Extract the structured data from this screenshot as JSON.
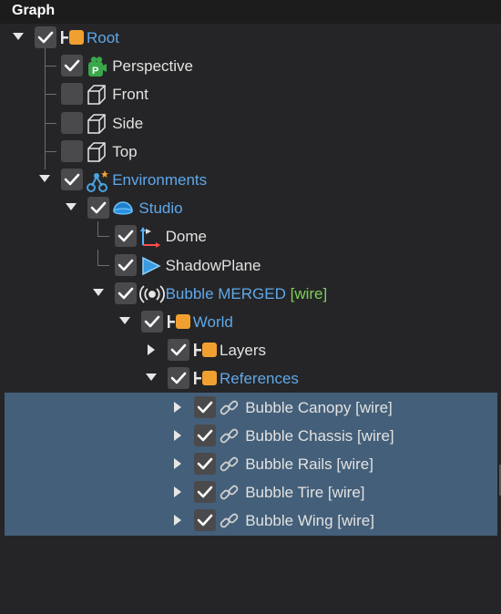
{
  "panel": {
    "title": "Graph"
  },
  "colors": {
    "label_default": "#e2e2e2",
    "label_blue": "#5fa8ea",
    "tag_green": "#7ccf58",
    "icon_orange": "#f0a030",
    "selection": "#445f79"
  },
  "tree": {
    "rows": [
      {
        "id": "root",
        "label": "Root",
        "tag": "",
        "icon": "group-node-icon",
        "checked": true,
        "expander": "expanded",
        "label_color": "blue",
        "selected": false
      },
      {
        "id": "perspective",
        "label": "Perspective",
        "tag": "",
        "icon": "perspective-camera-icon",
        "checked": true,
        "expander": "none",
        "label_color": "default",
        "selected": false
      },
      {
        "id": "front",
        "label": "Front",
        "tag": "",
        "icon": "ortho-camera-icon",
        "checked": false,
        "expander": "none",
        "label_color": "default",
        "selected": false
      },
      {
        "id": "side",
        "label": "Side",
        "tag": "",
        "icon": "ortho-camera-icon",
        "checked": false,
        "expander": "none",
        "label_color": "default",
        "selected": false
      },
      {
        "id": "top",
        "label": "Top",
        "tag": "",
        "icon": "ortho-camera-icon",
        "checked": false,
        "expander": "none",
        "label_color": "default",
        "selected": false
      },
      {
        "id": "environments",
        "label": "Environments",
        "tag": "",
        "icon": "environments-icon",
        "checked": true,
        "expander": "expanded",
        "label_color": "blue",
        "selected": false
      },
      {
        "id": "studio",
        "label": "Studio",
        "tag": "",
        "icon": "environment-dome-icon",
        "checked": true,
        "expander": "expanded",
        "label_color": "blue",
        "selected": false
      },
      {
        "id": "dome",
        "label": "Dome",
        "tag": "",
        "icon": "dome-light-icon",
        "checked": true,
        "expander": "none",
        "label_color": "default",
        "selected": false
      },
      {
        "id": "shadowplane",
        "label": "ShadowPlane",
        "tag": "",
        "icon": "shadow-plane-icon",
        "checked": true,
        "expander": "none",
        "label_color": "default",
        "selected": false
      },
      {
        "id": "bubble-merged",
        "label": "Bubble MERGED",
        "tag": "[wire]",
        "icon": "radio-source-icon",
        "checked": true,
        "expander": "expanded",
        "label_color": "blue",
        "selected": false
      },
      {
        "id": "world",
        "label": "World",
        "tag": "",
        "icon": "group-node-icon",
        "checked": true,
        "expander": "expanded",
        "label_color": "blue",
        "selected": false
      },
      {
        "id": "layers",
        "label": "Layers",
        "tag": "",
        "icon": "group-node-icon",
        "checked": true,
        "expander": "collapsed",
        "label_color": "default",
        "selected": false
      },
      {
        "id": "references",
        "label": "References",
        "tag": "",
        "icon": "group-node-icon",
        "checked": true,
        "expander": "expanded",
        "label_color": "blue",
        "selected": false
      },
      {
        "id": "bubble-canopy",
        "label": "Bubble Canopy [wire]",
        "tag": "",
        "icon": "link-icon",
        "checked": true,
        "expander": "collapsed",
        "label_color": "default",
        "selected": true
      },
      {
        "id": "bubble-chassis",
        "label": "Bubble Chassis [wire]",
        "tag": "",
        "icon": "link-icon",
        "checked": true,
        "expander": "collapsed",
        "label_color": "default",
        "selected": true
      },
      {
        "id": "bubble-rails",
        "label": "Bubble Rails [wire]",
        "tag": "",
        "icon": "link-icon",
        "checked": true,
        "expander": "collapsed",
        "label_color": "default",
        "selected": true
      },
      {
        "id": "bubble-tire",
        "label": "Bubble Tire [wire]",
        "tag": "",
        "icon": "link-icon",
        "checked": true,
        "expander": "collapsed",
        "label_color": "default",
        "selected": true
      },
      {
        "id": "bubble-wing",
        "label": "Bubble Wing [wire]",
        "tag": "",
        "icon": "link-icon",
        "checked": true,
        "expander": "collapsed",
        "label_color": "default",
        "selected": true
      }
    ]
  }
}
